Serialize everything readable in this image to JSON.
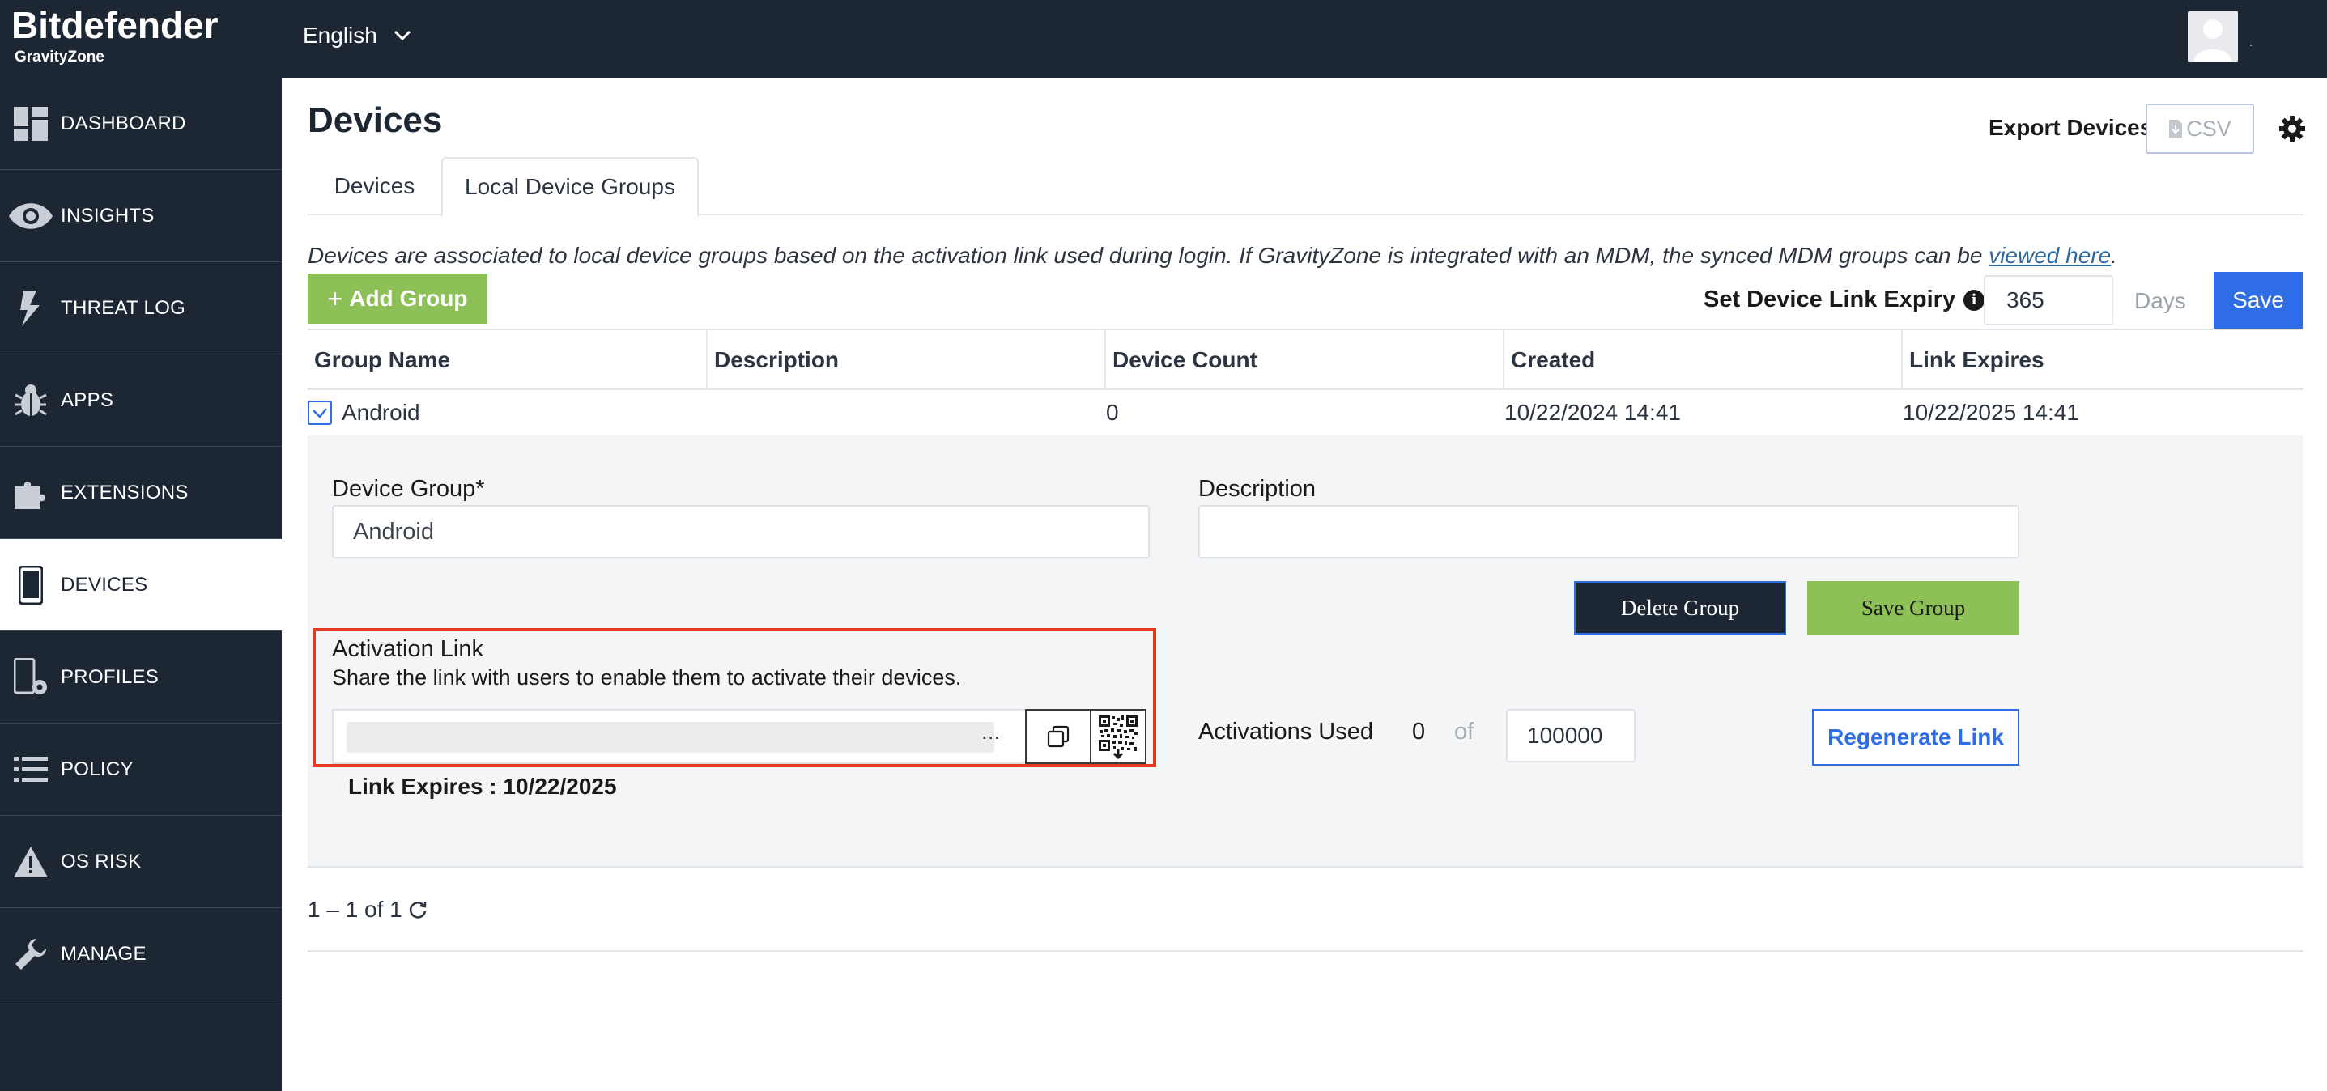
{
  "header": {
    "brand": "Bitdefender",
    "product": "GravityZone",
    "language": "English"
  },
  "sidebar": {
    "items": [
      {
        "label": "DASHBOARD",
        "icon": "dashboard-icon"
      },
      {
        "label": "INSIGHTS",
        "icon": "eye-icon"
      },
      {
        "label": "THREAT LOG",
        "icon": "lightning-icon"
      },
      {
        "label": "APPS",
        "icon": "bug-icon"
      },
      {
        "label": "EXTENSIONS",
        "icon": "puzzle-icon"
      },
      {
        "label": "DEVICES",
        "icon": "phone-icon",
        "active": true
      },
      {
        "label": "PROFILES",
        "icon": "phone-gear-icon"
      },
      {
        "label": "POLICY",
        "icon": "list-icon"
      },
      {
        "label": "OS RISK",
        "icon": "warning-icon"
      },
      {
        "label": "MANAGE",
        "icon": "wrench-icon"
      }
    ]
  },
  "page": {
    "title": "Devices",
    "export_label": "Export Devices",
    "csv_label": "CSV"
  },
  "tabs": [
    {
      "label": "Devices"
    },
    {
      "label": "Local Device Groups",
      "active": true
    }
  ],
  "info": {
    "text": "Devices are associated to local device groups based on the activation link used during login. If GravityZone is integrated with an MDM, the synced MDM groups can be ",
    "link": "viewed here",
    "end": "."
  },
  "toolbar": {
    "add_group": "Add Group",
    "expiry_label": "Set Device Link Expiry",
    "expiry_value": "365",
    "days": "Days",
    "save": "Save"
  },
  "table": {
    "columns": [
      "Group Name",
      "Description",
      "Device Count",
      "Created",
      "Link Expires"
    ],
    "rows": [
      {
        "group": "Android",
        "description": "",
        "count": "0",
        "created": "10/22/2024 14:41",
        "expires": "10/22/2025 14:41"
      }
    ]
  },
  "detail": {
    "group_label": "Device Group*",
    "group_value": "Android",
    "description_label": "Description",
    "description_value": "",
    "delete_label": "Delete Group",
    "save_label": "Save Group",
    "activation_title": "Activation Link",
    "activation_sub": "Share the link with users to enable them to activate their devices.",
    "link_ellipsis": "...",
    "link_expires": "Link Expires : 10/22/2025",
    "activations_label": "Activations Used",
    "activations_used": "0",
    "of": "of",
    "activations_max": "100000",
    "regenerate": "Regenerate Link"
  },
  "pager": {
    "text": "1 – 1 of 1"
  },
  "colors": {
    "nav_bg": "#1d2633",
    "green": "#8dc057",
    "blue": "#2f6de6",
    "highlight_red": "#e33b22"
  }
}
